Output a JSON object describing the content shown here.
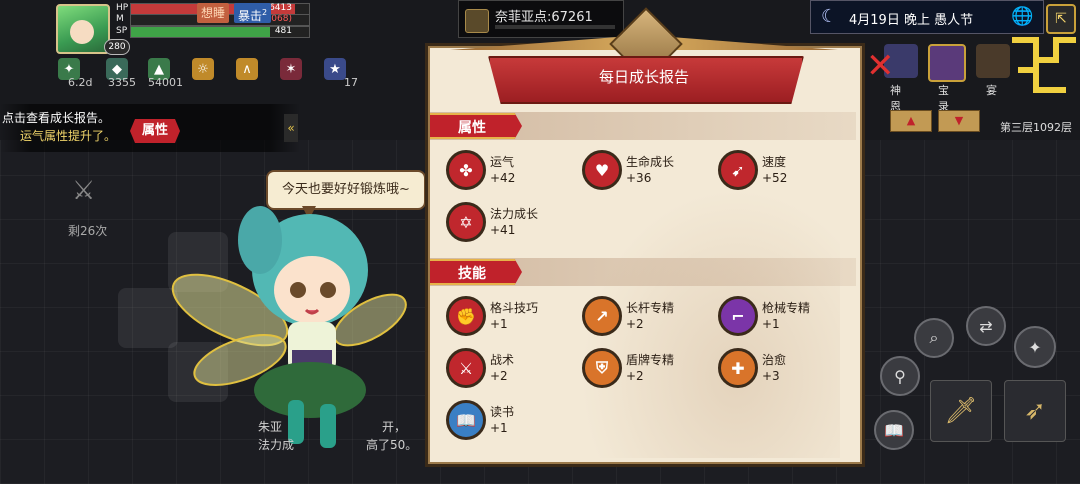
{
  "hud": {
    "hp_label": "HP",
    "hp_value": "1486413",
    "mp_label": "M",
    "mp_value": "(-4173068)",
    "sp_label": "SP",
    "sp_value": "481",
    "hp_fill": 0.92,
    "mp_fill": 0.0,
    "sp_fill": 0.78,
    "level": "280",
    "chip_sleepy": "想睡",
    "chip_crit": "暴击",
    "chip_crit_level": "2"
  },
  "status_values": [
    "6.2d",
    "3355",
    "54001",
    "",
    "",
    "",
    "17"
  ],
  "notification": {
    "line1": "点击查看成长报告。",
    "line2": "运气属性提升了。",
    "button": "属性",
    "collapse": "«"
  },
  "sword_count": "剩26次",
  "speech_bubble": "今天也要好好锻炼哦~",
  "npc_text": {
    "line1": "朱亚",
    "line1b": "开，",
    "line2": "法力成",
    "line2b": "高了50。"
  },
  "currency": {
    "label": "奈菲亚点:67261"
  },
  "datebar": {
    "date": "4月19日 晚上 愚人节"
  },
  "right_panel": {
    "icons": [
      "神恩",
      "宝录",
      "宴"
    ],
    "up_arrow": "▲",
    "down_arrow": "▼",
    "floor": "第三层1092层"
  },
  "dialog": {
    "title": "每日成长报告",
    "attr_section": "属性",
    "skill_section": "技能",
    "attributes": [
      {
        "name": "运气",
        "value": "+42",
        "icon": "clover-icon",
        "color": "#c0272d"
      },
      {
        "name": "生命成长",
        "value": "+36",
        "icon": "heart-icon",
        "color": "#c0272d"
      },
      {
        "name": "速度",
        "value": "+52",
        "icon": "wing-icon",
        "color": "#c0272d"
      },
      {
        "name": "法力成长",
        "value": "+41",
        "icon": "magic-circle-icon",
        "color": "#c0272d"
      }
    ],
    "skills": [
      {
        "name": "格斗技巧",
        "value": "+1",
        "icon": "fist-icon",
        "color": "#c0272d"
      },
      {
        "name": "长杆专精",
        "value": "+2",
        "icon": "spear-icon",
        "color": "#d9742a"
      },
      {
        "name": "枪械专精",
        "value": "+1",
        "icon": "gun-icon",
        "color": "#7b35a8"
      },
      {
        "name": "战术",
        "value": "+2",
        "icon": "tactics-icon",
        "color": "#c0272d"
      },
      {
        "name": "盾牌专精",
        "value": "+2",
        "icon": "shield-icon",
        "color": "#d9742a"
      },
      {
        "name": "治愈",
        "value": "+3",
        "icon": "heal-icon",
        "color": "#d9742a"
      },
      {
        "name": "读书",
        "value": "+1",
        "icon": "book-icon",
        "color": "#3a7fc4"
      }
    ]
  }
}
